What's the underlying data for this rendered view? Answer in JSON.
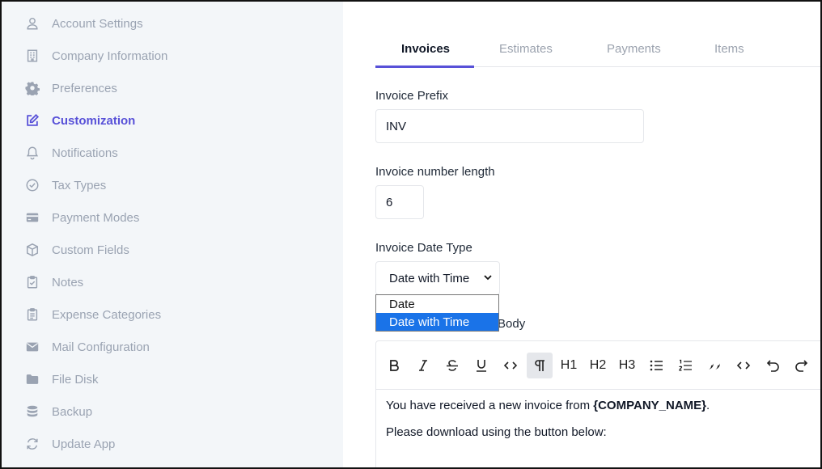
{
  "sidebar": {
    "items": [
      {
        "label": "Account Settings",
        "icon": "user-icon"
      },
      {
        "label": "Company Information",
        "icon": "building-icon"
      },
      {
        "label": "Preferences",
        "icon": "gear-icon"
      },
      {
        "label": "Customization",
        "icon": "edit-icon",
        "active": true
      },
      {
        "label": "Notifications",
        "icon": "bell-icon"
      },
      {
        "label": "Tax Types",
        "icon": "check-circle-icon"
      },
      {
        "label": "Payment Modes",
        "icon": "credit-card-icon"
      },
      {
        "label": "Custom Fields",
        "icon": "cube-icon"
      },
      {
        "label": "Notes",
        "icon": "clipboard-check-icon"
      },
      {
        "label": "Expense Categories",
        "icon": "clipboard-list-icon"
      },
      {
        "label": "Mail Configuration",
        "icon": "mail-icon"
      },
      {
        "label": "File Disk",
        "icon": "folder-icon"
      },
      {
        "label": "Backup",
        "icon": "database-icon"
      },
      {
        "label": "Update App",
        "icon": "refresh-icon"
      }
    ]
  },
  "tabs": [
    {
      "label": "Invoices",
      "active": true
    },
    {
      "label": "Estimates"
    },
    {
      "label": "Payments"
    },
    {
      "label": "Items"
    }
  ],
  "form": {
    "prefix_label": "Invoice Prefix",
    "prefix_value": "INV",
    "number_length_label": "Invoice number length",
    "number_length_value": "6",
    "date_type_label": "Invoice Date Type",
    "date_type_value": "Date with Time",
    "date_type_options": [
      "Date",
      "Date with Time"
    ],
    "body_label_visible": "Body"
  },
  "editor": {
    "toolbar": [
      "bold",
      "italic",
      "strikethrough",
      "underline",
      "code",
      "paragraph",
      "H1",
      "H2",
      "H3",
      "bullet-list",
      "ordered-list",
      "quote",
      "code-block",
      "undo",
      "redo"
    ],
    "line1_text": "You have received a new invoice from ",
    "line1_bold": "{COMPANY_NAME}",
    "line1_end": ".",
    "line2": "Please download using the button below:"
  },
  "colors": {
    "accent": "#5851d8",
    "sidebar_bg": "#f3f6f9",
    "select_highlight": "#1a73e8"
  }
}
